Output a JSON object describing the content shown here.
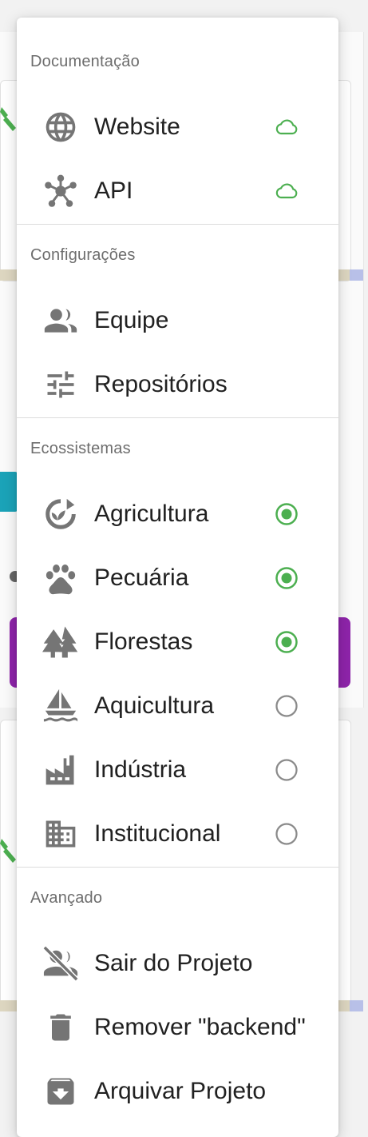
{
  "colors": {
    "icon": "#757575",
    "text": "#212121",
    "section_title": "#6d6d6d",
    "accent_green": "#4caf50",
    "radio_off": "#8a8a8a"
  },
  "menu": {
    "sections": [
      {
        "title": "Documentação",
        "items": [
          {
            "label": "Website",
            "icon": "globe-icon",
            "trailing": "cloud-icon"
          },
          {
            "label": "API",
            "icon": "api-network-icon",
            "trailing": "cloud-icon"
          }
        ]
      },
      {
        "title": "Configurações",
        "items": [
          {
            "label": "Equipe",
            "icon": "people-icon"
          },
          {
            "label": "Repositórios",
            "icon": "tune-sliders-icon"
          }
        ]
      },
      {
        "title": "Ecossistemas",
        "items": [
          {
            "label": "Agricultura",
            "icon": "agriculture-icon",
            "selected": true
          },
          {
            "label": "Pecuária",
            "icon": "paw-icon",
            "selected": true
          },
          {
            "label": "Florestas",
            "icon": "forest-icon",
            "selected": true
          },
          {
            "label": "Aquicultura",
            "icon": "sailboat-icon",
            "selected": false
          },
          {
            "label": "Indústria",
            "icon": "factory-icon",
            "selected": false
          },
          {
            "label": "Institucional",
            "icon": "building-icon",
            "selected": false
          }
        ]
      },
      {
        "title": "Avançado",
        "items": [
          {
            "label": "Sair do Projeto",
            "icon": "person-off-icon"
          },
          {
            "label": "Remover \"backend\"",
            "icon": "trash-icon"
          },
          {
            "label": "Arquivar Projeto",
            "icon": "archive-icon"
          }
        ]
      }
    ]
  }
}
